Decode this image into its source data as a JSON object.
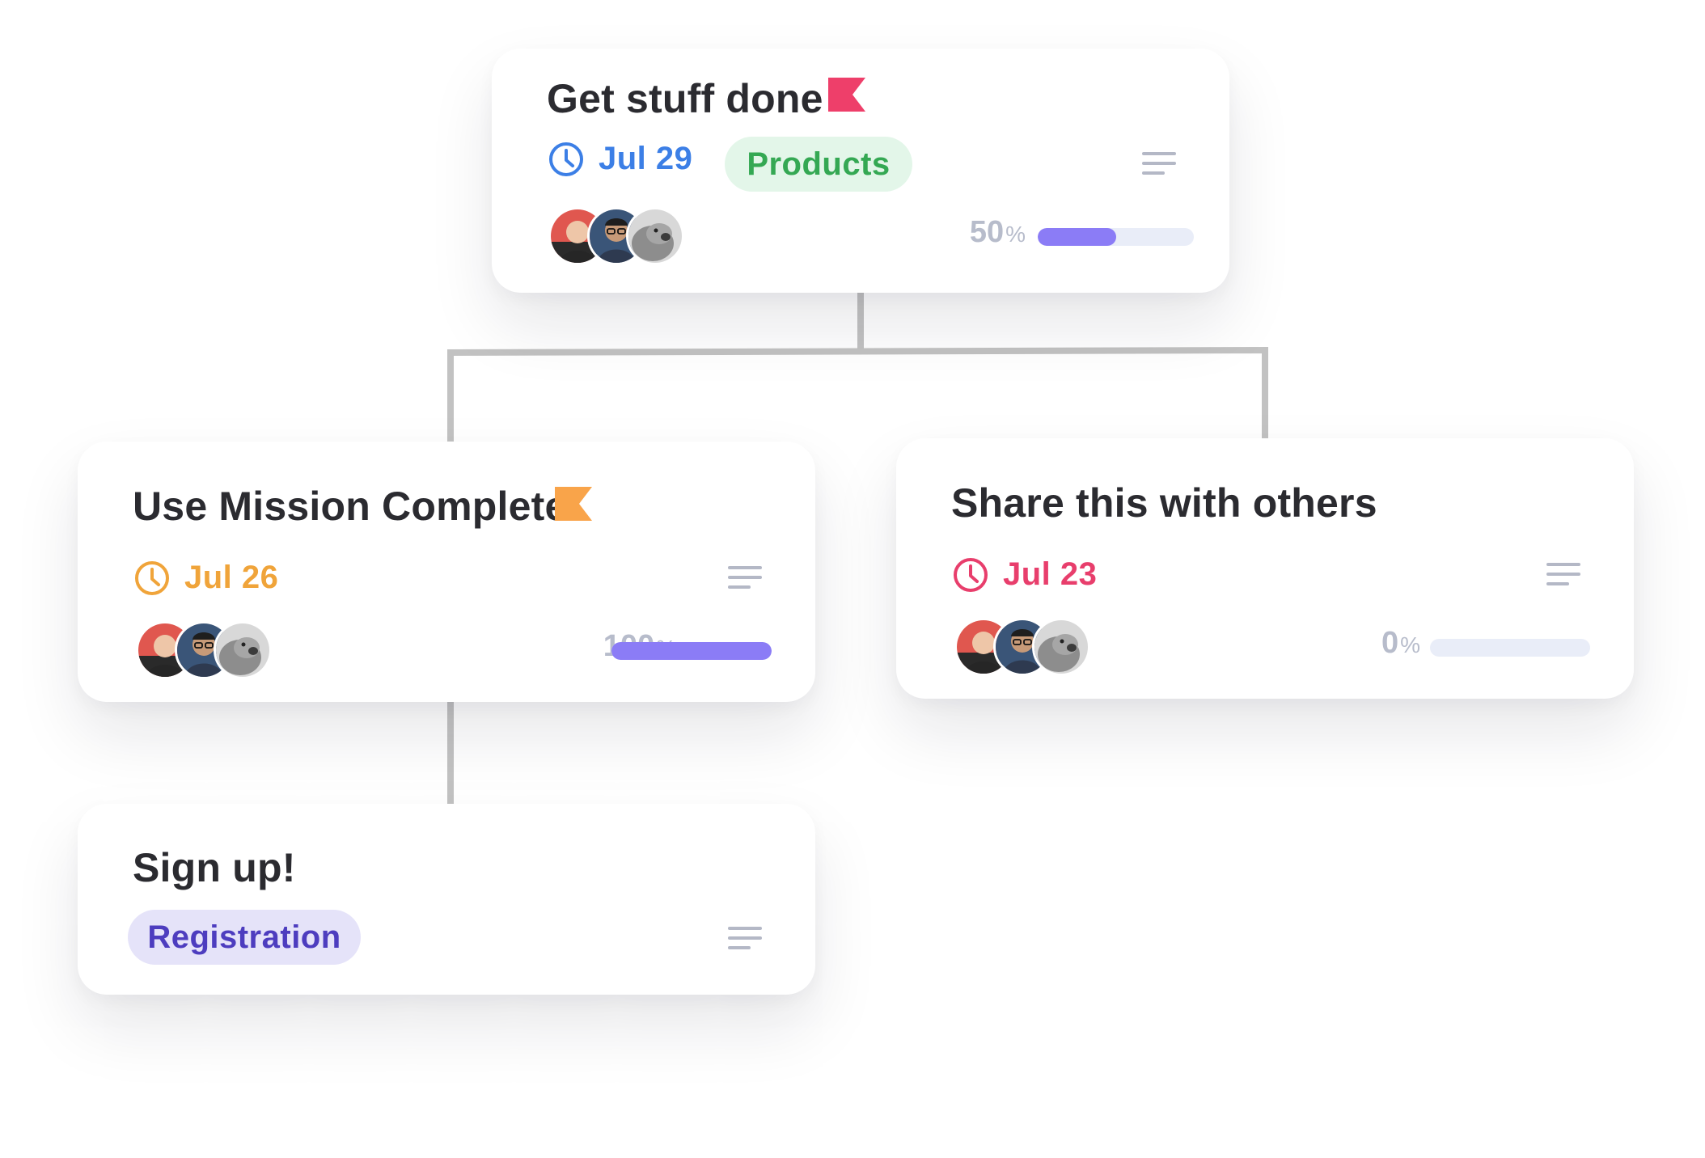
{
  "colors": {
    "connector": "#c2c2c2",
    "title": "#2b2b30",
    "blue": "#3c7fe6",
    "orange": "#f0a43a",
    "pink": "#e83e6c",
    "progress_fill": "#8b7cf6",
    "progress_track": "#e9edf8",
    "percent_text": "#b7bccb",
    "menu_icon": "#b4b8c6"
  },
  "cards": {
    "root": {
      "title": "Get stuff done",
      "flag_color": "#ee3f6a",
      "due_date": "Jul 29",
      "due_color": "#3c7fe6",
      "tag": {
        "label": "Products",
        "bg": "#e3f6e9",
        "color": "#34a853"
      },
      "assignees": [
        "person-red-shirt",
        "person-glasses",
        "seal"
      ],
      "progress": {
        "value": 50,
        "unit": "%"
      }
    },
    "left": {
      "title": "Use Mission Complete",
      "flag_color": "#f9a44a",
      "due_date": "Jul 26",
      "due_color": "#f0a43a",
      "assignees": [
        "person-red-shirt",
        "person-glasses",
        "seal"
      ],
      "progress": {
        "value": 100,
        "unit": "%"
      }
    },
    "right": {
      "title": "Share this with others",
      "due_date": "Jul 23",
      "due_color": "#e83e6c",
      "assignees": [
        "person-red-shirt",
        "person-glasses",
        "seal"
      ],
      "progress": {
        "value": 0,
        "unit": "%"
      }
    },
    "child": {
      "title": "Sign up!",
      "tag": {
        "label": "Registration",
        "bg": "#e5e3f9",
        "color": "#4d3dbf"
      }
    }
  }
}
